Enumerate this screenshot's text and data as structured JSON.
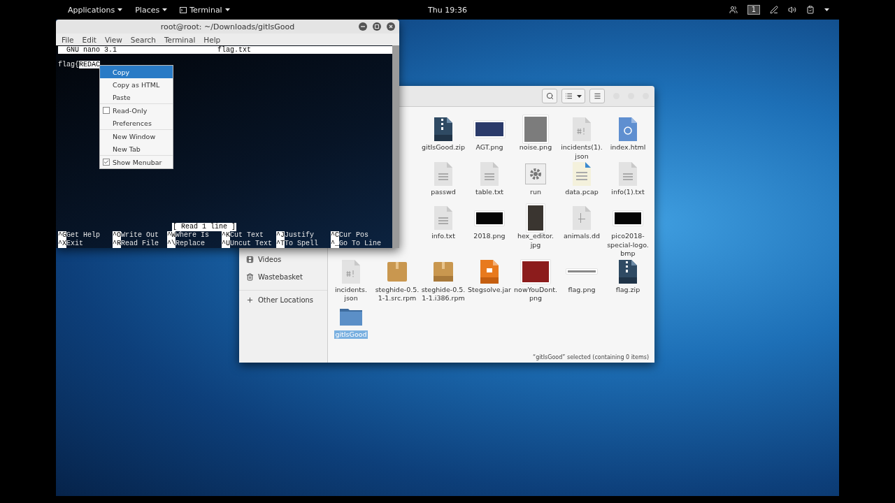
{
  "top_bar": {
    "menus": [
      {
        "label": "Applications",
        "kind": "plain"
      },
      {
        "label": "Places",
        "kind": "plain"
      },
      {
        "label": "Terminal",
        "kind": "app"
      }
    ],
    "clock": "Thu 19:36",
    "workspace": "1"
  },
  "terminal": {
    "title": "root@root: ~/Downloads/gitIsGood",
    "menu": [
      "File",
      "Edit",
      "View",
      "Search",
      "Terminal",
      "Help"
    ],
    "nano": {
      "version": "GNU nano 3.1",
      "filename": "flag.txt",
      "text": "flag{",
      "selected_text": "REDAC",
      "status": "[ Read 1 line ]",
      "shortcuts": [
        [
          {
            "key": "^G",
            "label": "Get Help"
          },
          {
            "key": "^O",
            "label": "Write Out"
          },
          {
            "key": "^W",
            "label": "Where Is"
          },
          {
            "key": "^K",
            "label": "Cut Text"
          },
          {
            "key": "^J",
            "label": "Justify"
          },
          {
            "key": "^C",
            "label": "Cur Pos"
          }
        ],
        [
          {
            "key": "^X",
            "label": "Exit"
          },
          {
            "key": "^R",
            "label": "Read File"
          },
          {
            "key": "^\\",
            "label": "Replace"
          },
          {
            "key": "^U",
            "label": "Uncut Text"
          },
          {
            "key": "^T",
            "label": "To Spell"
          },
          {
            "key": "^_",
            "label": "Go To Line"
          }
        ]
      ]
    }
  },
  "context_menu": {
    "groups": [
      [
        {
          "label": "Copy",
          "kind": "plain",
          "selected": true
        },
        {
          "label": "Copy as HTML",
          "kind": "plain",
          "selected": false
        },
        {
          "label": "Paste",
          "kind": "plain",
          "selected": false
        }
      ],
      [
        {
          "label": "Read-Only",
          "kind": "check",
          "checked": false,
          "selected": false
        },
        {
          "label": "Preferences",
          "kind": "plain",
          "selected": false
        }
      ],
      [
        {
          "label": "New Window",
          "kind": "plain",
          "selected": false
        },
        {
          "label": "New Tab",
          "kind": "plain",
          "selected": false
        }
      ],
      [
        {
          "label": "Show Menubar",
          "kind": "check",
          "checked": true,
          "selected": false
        }
      ]
    ]
  },
  "file_manager": {
    "sidebar": [
      {
        "label": "Videos",
        "kind": "videos"
      },
      {
        "label": "Wastebasket",
        "kind": "trash"
      },
      {
        "label": "Other Locations",
        "kind": "other"
      }
    ],
    "files": [
      {
        "kind": "covered"
      },
      {
        "kind": "covered"
      },
      {
        "name": "gitIsGood.zip",
        "kind": "zip",
        "selected": false
      },
      {
        "name": "AGT.png",
        "kind": "photo",
        "selected": false
      },
      {
        "name": "noise.png",
        "kind": "noise",
        "selected": false
      },
      {
        "name": "incidents(1).json",
        "kind": "script",
        "selected": false
      },
      {
        "name": "index.html",
        "kind": "html",
        "selected": false
      },
      {
        "kind": "covered"
      },
      {
        "kind": "covered"
      },
      {
        "name": "passwd",
        "kind": "text",
        "selected": false
      },
      {
        "name": "table.txt",
        "kind": "text",
        "selected": false
      },
      {
        "name": "run",
        "kind": "exec",
        "selected": false
      },
      {
        "name": "data.pcap",
        "kind": "data",
        "selected": false
      },
      {
        "name": "info(1).txt",
        "kind": "text",
        "selected": false
      },
      {
        "kind": "covered"
      },
      {
        "kind": "covered"
      },
      {
        "name": "info.txt",
        "kind": "text",
        "selected": false
      },
      {
        "name": "2018.png",
        "kind": "banner",
        "selected": false
      },
      {
        "name": "hex_editor.jpg",
        "kind": "portrait",
        "selected": false
      },
      {
        "name": "animals.dd",
        "kind": "binary",
        "selected": false
      },
      {
        "name": "pico2018-special-logo.bmp",
        "kind": "banner",
        "selected": false
      },
      {
        "name": "incidents.json",
        "kind": "script",
        "selected": false
      },
      {
        "name": "steghide-0.5.1-1.src.rpm",
        "kind": "package",
        "selected": false
      },
      {
        "name": "steghide-0.5.1-1.i386.rpm",
        "kind": "rpm",
        "selected": false
      },
      {
        "name": "Stegsolve.jar",
        "kind": "jar",
        "selected": false
      },
      {
        "name": "nowYouDont.png",
        "kind": "red",
        "selected": false
      },
      {
        "name": "flag.png",
        "kind": "strip",
        "selected": false
      },
      {
        "name": "flag.zip",
        "kind": "zip",
        "selected": false
      },
      {
        "name": "gitIsGood",
        "kind": "folder",
        "selected": true
      }
    ],
    "status": "“gitIsGood” selected  (containing 0 items)"
  }
}
